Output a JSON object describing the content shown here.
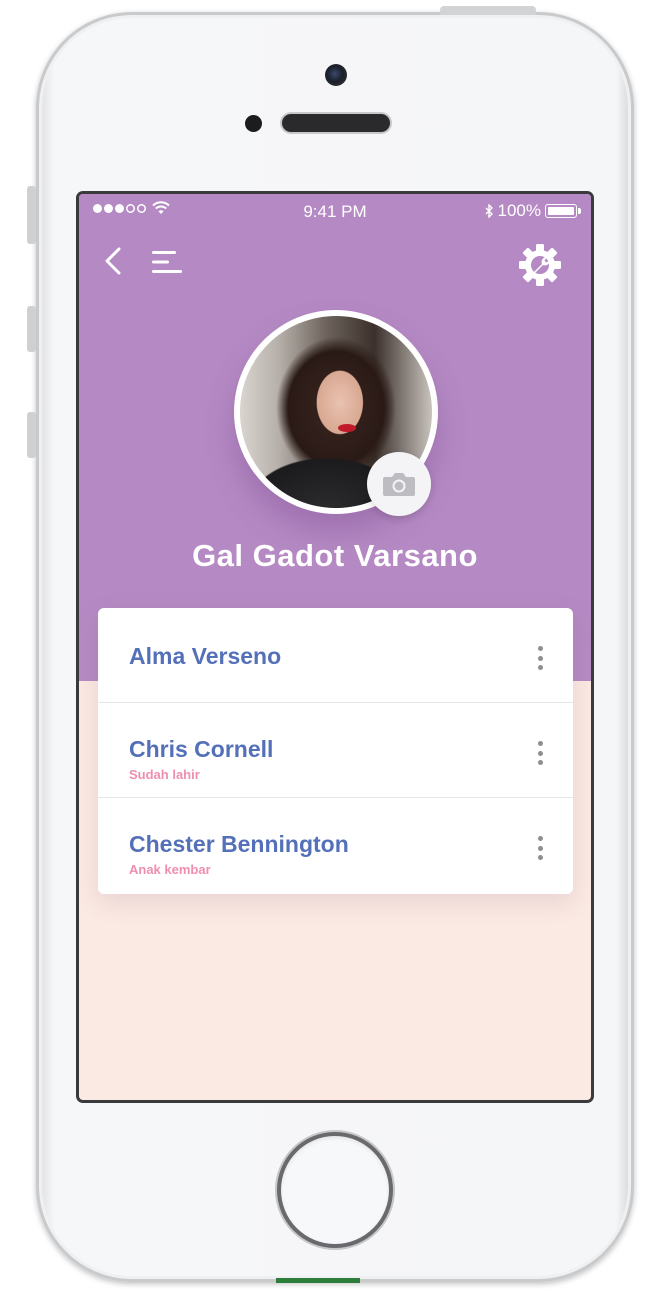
{
  "status_bar": {
    "time": "9:41 PM",
    "battery": "100%"
  },
  "profile": {
    "name": "Gal Gadot Varsano"
  },
  "list": [
    {
      "title": "Alma Verseno",
      "subtitle": ""
    },
    {
      "title": "Chris Cornell",
      "subtitle": "Sudah lahir"
    },
    {
      "title": "Chester Bennington",
      "subtitle": "Anak kembar"
    }
  ],
  "colors": {
    "header_purple": "#b58ac4",
    "background_peach": "#fbe9e3",
    "title_blue": "#5470b8",
    "subtitle_pink": "#f08db0"
  },
  "icons": {
    "back": "chevron-left-icon",
    "menu": "menu-icon",
    "settings": "settings-wrench-icon",
    "camera": "camera-icon",
    "more": "more-vertical-icon"
  }
}
